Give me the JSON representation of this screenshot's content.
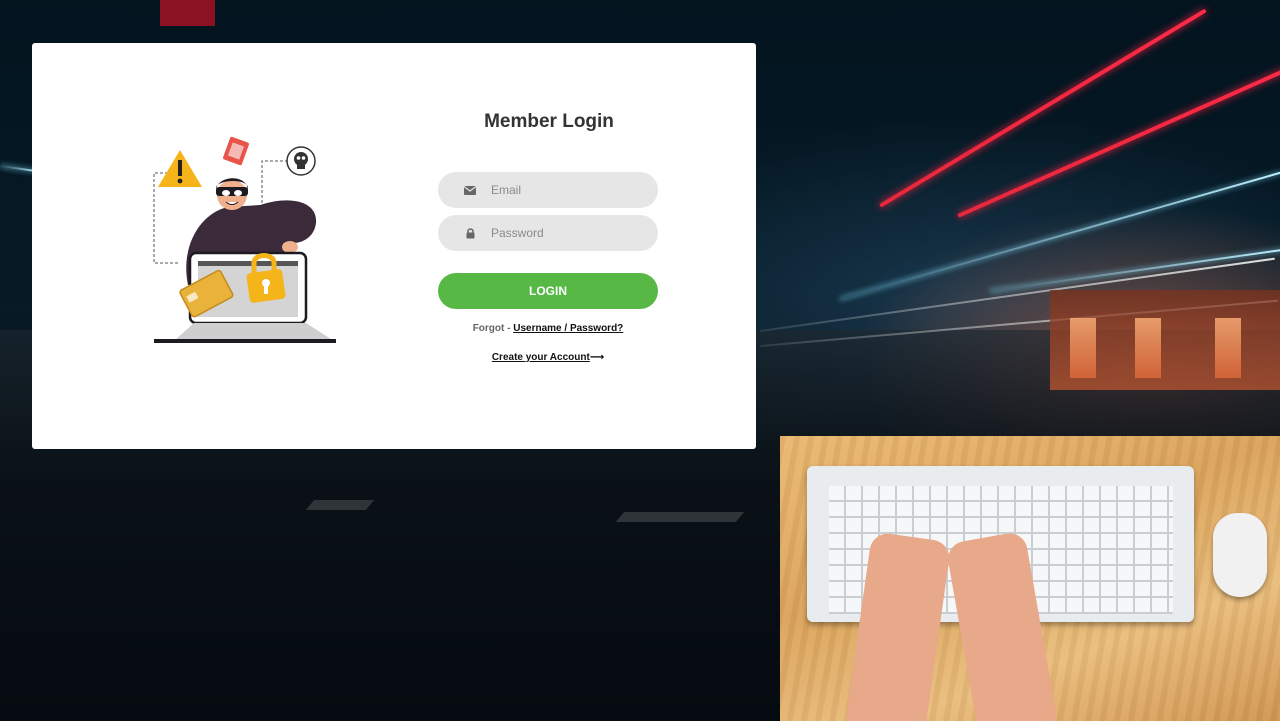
{
  "login": {
    "title": "Member Login",
    "email_placeholder": "Email",
    "password_placeholder": "Password",
    "login_button": "LOGIN",
    "forgot_prefix": "Forgot - ",
    "forgot_link": "Username / Password?",
    "create_account": "Create your Account",
    "create_arrow": "⟶"
  },
  "icons": {
    "email": "envelope-icon",
    "password": "lock-icon",
    "illustration": "hacker-illustration"
  },
  "colors": {
    "accent_green": "#57b846",
    "input_bg": "#e6e6e6",
    "title_text": "#333333",
    "warning_yellow": "#f4b41a"
  }
}
